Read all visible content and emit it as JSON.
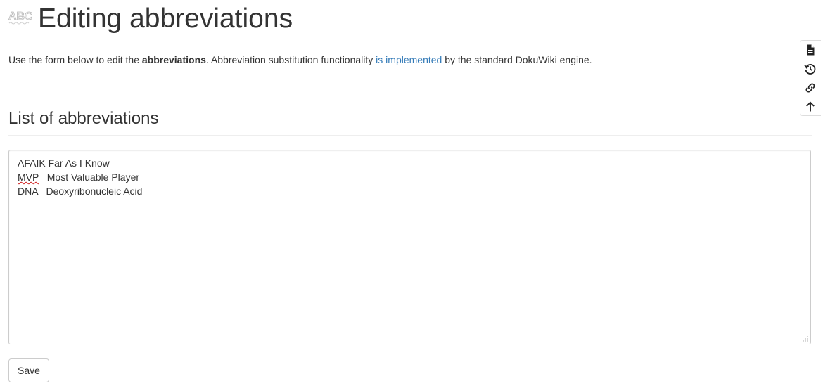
{
  "header": {
    "icon": "abc-abbreviations-icon",
    "title": "Editing abbreviations"
  },
  "intro": {
    "prefix": "Use the form below to edit the ",
    "bold": "abbreviations",
    "middle": ". Abbreviation substitution functionality ",
    "link": "is implemented",
    "suffix": " by the standard DokuWiki engine."
  },
  "section": {
    "title": "List of abbreviations"
  },
  "abbreviations": {
    "lines": [
      {
        "abbr": "AFAIK",
        "sep": " ",
        "meaning": "Far As I Know",
        "misspelled": false
      },
      {
        "abbr": "MVP",
        "sep": "   ",
        "meaning": "Most Valuable Player",
        "misspelled": true
      },
      {
        "abbr": "DNA",
        "sep": "   ",
        "meaning": "Deoxyribonucleic Acid",
        "misspelled": false
      }
    ]
  },
  "form": {
    "save_label": "Save"
  },
  "page_tools": [
    {
      "name": "show-page-icon"
    },
    {
      "name": "old-revisions-icon"
    },
    {
      "name": "backlinks-icon"
    },
    {
      "name": "back-to-top-icon"
    }
  ],
  "colors": {
    "link": "#337ab7",
    "text": "#333333",
    "spellcheck": "#d02020"
  }
}
